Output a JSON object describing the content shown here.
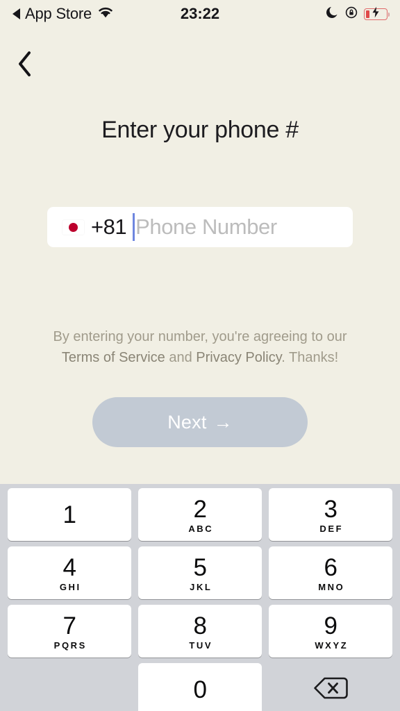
{
  "statusbar": {
    "back_label": "App Store",
    "back_triangle_icon": "triangle-left-icon",
    "wifi_icon": "wifi-icon",
    "time": "23:22",
    "dnd_icon": "crescent-moon-icon",
    "rotation_lock_icon": "rotation-lock-icon",
    "battery_icon": "battery-charging-low-icon",
    "battery_color": "#E04A4A"
  },
  "nav": {
    "back_icon": "chevron-left-icon"
  },
  "main": {
    "title": "Enter your phone #",
    "phone_input": {
      "flag_icon": "flag-japan-icon",
      "dial_code": "+81",
      "placeholder": "Phone Number",
      "value": "",
      "caret_color": "#6E86DF"
    },
    "terms": {
      "line1_prefix": "By entering your number, you're agreeing to our",
      "terms_link": "Terms of Service",
      "conjunction": " and ",
      "privacy_link": "Privacy Policy",
      "suffix": ". Thanks!"
    },
    "next_button": {
      "label": "Next",
      "arrow": "→",
      "arrow_icon": "arrow-right-icon",
      "color": "#C2CAD4",
      "enabled": false
    }
  },
  "keypad": {
    "background": "#D1D3D8",
    "rows": [
      [
        {
          "digit": "1",
          "letters": ""
        },
        {
          "digit": "2",
          "letters": "ABC"
        },
        {
          "digit": "3",
          "letters": "DEF"
        }
      ],
      [
        {
          "digit": "4",
          "letters": "GHI"
        },
        {
          "digit": "5",
          "letters": "JKL"
        },
        {
          "digit": "6",
          "letters": "MNO"
        }
      ],
      [
        {
          "digit": "7",
          "letters": "PQRS"
        },
        {
          "digit": "8",
          "letters": "TUV"
        },
        {
          "digit": "9",
          "letters": "WXYZ"
        }
      ]
    ],
    "zero": {
      "digit": "0",
      "letters": ""
    },
    "backspace_icon": "backspace-delete-icon"
  }
}
